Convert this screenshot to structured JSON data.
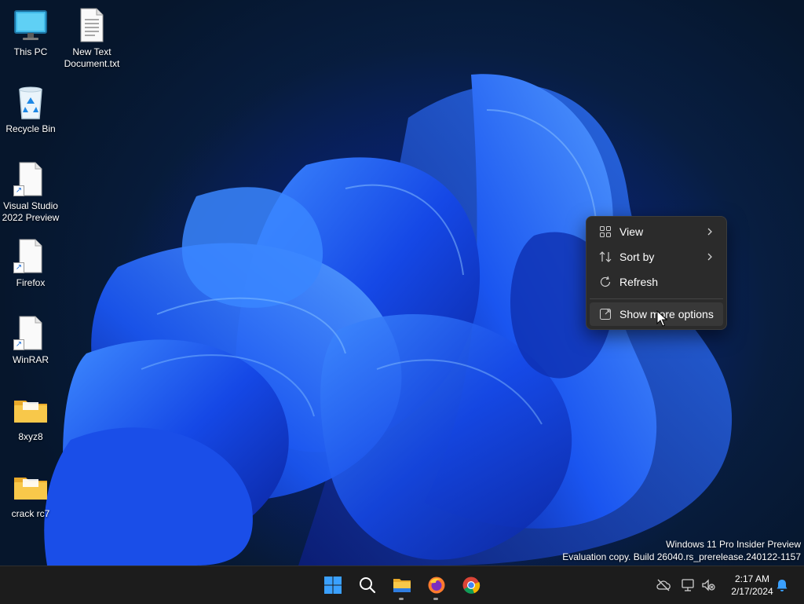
{
  "desktop_icons": [
    {
      "label": "This PC",
      "icon": "monitor-icon"
    },
    {
      "label": "New Text Document.txt",
      "icon": "text-document-icon"
    },
    {
      "label": "Recycle Bin",
      "icon": "recycle-bin-icon"
    },
    {
      "label": "Visual Studio 2022 Preview",
      "icon": "shortcut-file-icon"
    },
    {
      "label": "Firefox",
      "icon": "shortcut-file-icon"
    },
    {
      "label": "WinRAR",
      "icon": "shortcut-file-icon"
    },
    {
      "label": "8xyz8",
      "icon": "folder-icon"
    },
    {
      "label": "crack rc7",
      "icon": "folder-icon"
    }
  ],
  "context_menu": {
    "items": [
      {
        "label": "View",
        "icon": "grid-view-icon",
        "submenu": true
      },
      {
        "label": "Sort by",
        "icon": "sort-icon",
        "submenu": true
      },
      {
        "label": "Refresh",
        "icon": "refresh-icon",
        "submenu": false
      },
      {
        "label": "Show more options",
        "icon": "expand-icon",
        "submenu": false,
        "hovered": true
      }
    ]
  },
  "watermark": {
    "line1": "Windows 11 Pro Insider Preview",
    "line2": "Evaluation copy. Build 26040.rs_prerelease.240122-1157"
  },
  "taskbar": {
    "apps": [
      {
        "name": "Start",
        "icon": "windows-start-icon"
      },
      {
        "name": "Search",
        "icon": "search-icon"
      },
      {
        "name": "File Explorer",
        "icon": "file-explorer-icon",
        "running": true
      },
      {
        "name": "Firefox",
        "icon": "firefox-icon",
        "running": true
      },
      {
        "name": "Chrome",
        "icon": "chrome-icon"
      }
    ],
    "tray": [
      "cloud-offline-icon",
      "network-icon",
      "volume-muted-icon"
    ],
    "time": "2:17 AM",
    "date": "2/17/2024",
    "notification_icon": "bell-icon"
  },
  "colors": {
    "menu_bg": "#2b2b2b",
    "taskbar_bg": "#1c1c1c",
    "wallpaper_accent": "#1f5cff",
    "folder": "#f5c542"
  }
}
